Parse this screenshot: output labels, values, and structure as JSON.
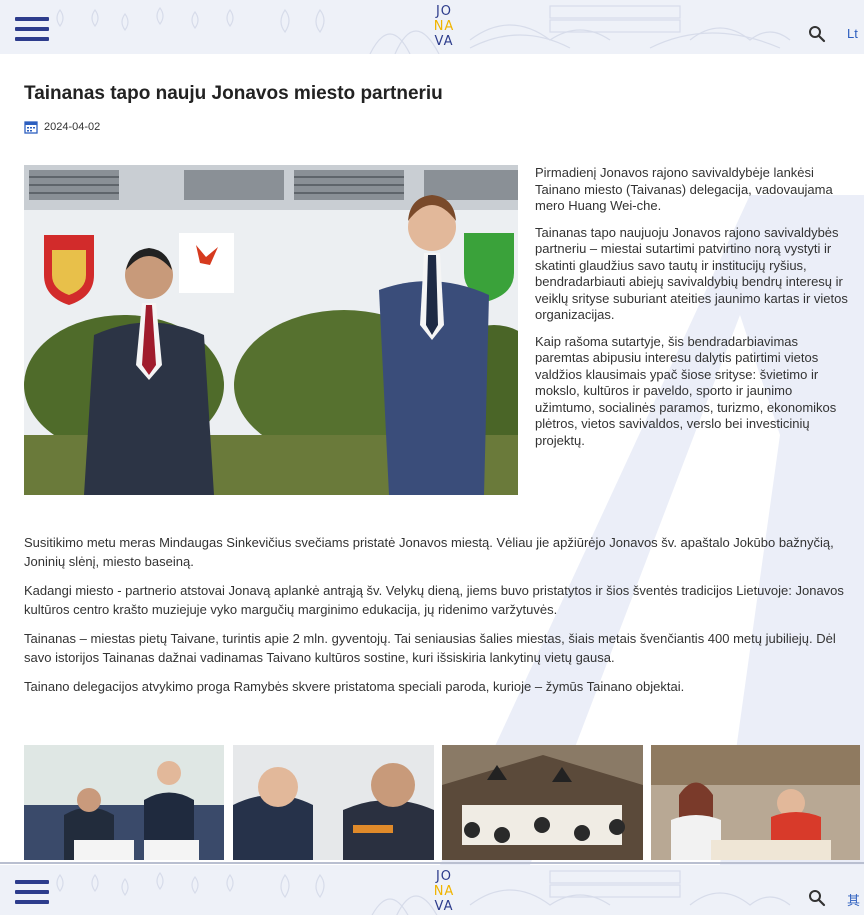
{
  "header": {
    "logo_lines": [
      "JO",
      "NA",
      "VA"
    ],
    "lang_top": "Lt",
    "lang_bottom": "其"
  },
  "article": {
    "title": "Tainanas tapo nauju Jonavos miesto partneriu",
    "date": "2024-04-02",
    "side_paragraphs": [
      "Pirmadienį Jonavos rajono savivaldybėje lankėsi Tainano miesto (Taivanas) delegacija, vadovaujama mero Huang Wei-che.",
      "Tainanas tapo naujuoju Jonavos rajono savivaldybės partneriu – miestai sutartimi patvirtino norą vystyti ir skatinti glaudžius savo tautų ir institucijų ryšius, bendradarbiauti abiejų savivaldybių bendrų interesų ir veiklų srityse suburiant ateities jaunimo kartas ir vietos organizacijas.",
      "Kaip rašoma sutartyje, šis bendradarbiavimas paremtas abipusiu interesu dalytis patirtimi vietos valdžios klausimais ypač šiose srityse: švietimo ir mokslo, kultūros ir paveldo, sporto ir jaunimo užimtumo, socialinės paramos, turizmo, ekonomikos plėtros, vietos savivaldos, verslo bei investicinių projektų."
    ],
    "body_paragraphs": [
      "Susitikimo metu meras Mindaugas Sinkevičius svečiams pristatė Jonavos miestą. Vėliau jie apžiūrėjo Jonavos šv. apaštalo Jokūbo bažnyčią, Joninių slėnį, miesto baseiną.",
      "Kadangi miesto - partnerio atstovai Jonavą aplankė antrąją šv. Velykų dieną, jiems buvo pristatytos ir šios šventės tradicijos Lietuvoje: Jonavos kultūros centro krašto muziejuje vyko margučių marginimo edukacija, jų ridenimo varžytuvės.",
      "Tainanas – miestas pietų Taivane, turintis apie 2 mln. gyventojų. Tai seniausias šalies miestas, šiais metais švenčiantis 400 metų jubiliejų. Dėl savo istorijos Tainanas dažnai vadinamas Taivano kultūros sostine, kuri išsiskiria lankytinų vietų gausa.",
      "Tainano delegacijos atvykimo proga Ramybės skvere pristatoma speciali paroda, kurioje – žymūs Tainano objektai."
    ]
  },
  "icons": {
    "menu": "hamburger-menu-icon",
    "search": "search-icon",
    "date": "calendar-icon"
  },
  "colors": {
    "brand_blue": "#2d3c8c",
    "logo_accent": "#f0b400",
    "header_bg": "#eef1f8",
    "link_blue": "#2d5fbf"
  }
}
